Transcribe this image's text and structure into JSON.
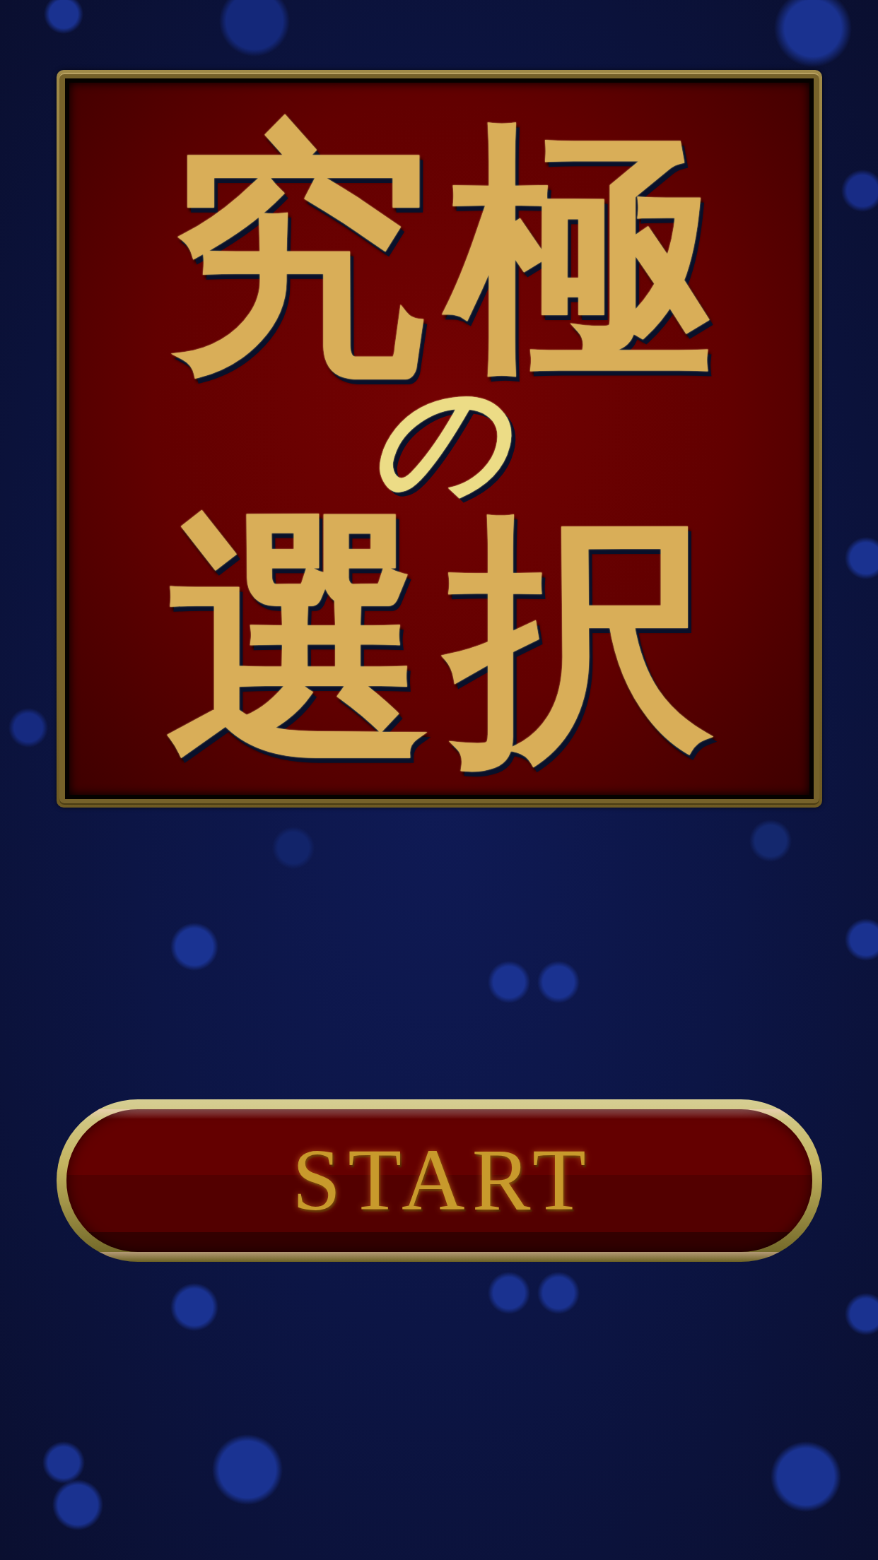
{
  "title_panel": {
    "lines": [
      {
        "text": "究極",
        "kind": "large"
      },
      {
        "text": "の",
        "kind": "small"
      },
      {
        "text": "選択",
        "kind": "large"
      }
    ]
  },
  "start_button": {
    "label": "START"
  }
}
